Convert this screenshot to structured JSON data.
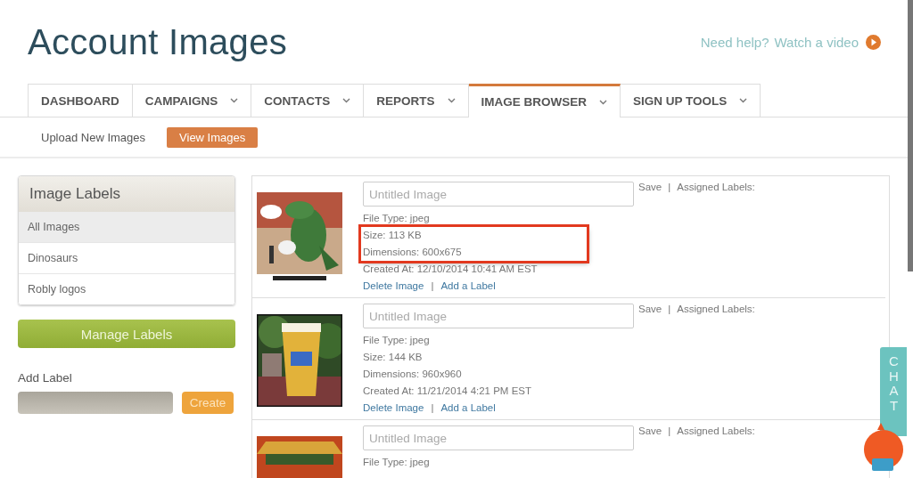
{
  "page": {
    "title": "Account Images",
    "help_text": "Need help?",
    "help_link": "Watch a video"
  },
  "tabs": [
    {
      "label": "DASHBOARD",
      "selected": false,
      "has_menu": false
    },
    {
      "label": "CAMPAIGNS",
      "selected": false,
      "has_menu": true
    },
    {
      "label": "CONTACTS",
      "selected": false,
      "has_menu": true
    },
    {
      "label": "REPORTS",
      "selected": false,
      "has_menu": true
    },
    {
      "label": "IMAGE BROWSER",
      "selected": true,
      "has_menu": true
    },
    {
      "label": "SIGN UP TOOLS",
      "selected": false,
      "has_menu": true
    }
  ],
  "subnav": [
    {
      "label": "Upload New Images",
      "selected": false
    },
    {
      "label": "View Images",
      "selected": true
    }
  ],
  "sidebar": {
    "title": "Image Labels",
    "labels": [
      {
        "label": "All Images",
        "selected": true
      },
      {
        "label": "Dinosaurs",
        "selected": false
      },
      {
        "label": "Robly logos",
        "selected": false
      }
    ],
    "manage_button": "Manage Labels",
    "add_label": {
      "heading": "Add Label",
      "button": "Create"
    }
  },
  "images": [
    {
      "kind": "comic",
      "placeholder": "Untitled Image",
      "save": "Save",
      "separator": "|",
      "assigned_labels": "Assigned Labels:",
      "file_type": "File Type: jpeg",
      "size": "Size: 113 KB",
      "dimensions": "Dimensions: 600x675",
      "created_at": "Created At: 12/10/2014 10:41 AM EST",
      "delete": "Delete Image",
      "add_label": "Add a Label",
      "highlighted": true
    },
    {
      "kind": "glass",
      "placeholder": "Untitled Image",
      "save": "Save",
      "separator": "|",
      "assigned_labels": "Assigned Labels:",
      "file_type": "File Type: jpeg",
      "size": "Size: 144 KB",
      "dimensions": "Dimensions: 960x960",
      "created_at": "Created At: 11/21/2014 4:21 PM EST",
      "delete": "Delete Image",
      "add_label": "Add a Label",
      "highlighted": false
    },
    {
      "kind": "banner",
      "placeholder": "Untitled Image",
      "save": "Save",
      "separator": "|",
      "assigned_labels": "Assigned Labels:",
      "file_type": "File Type: jpeg",
      "highlighted": false
    }
  ],
  "chat": {
    "label": "CHAT"
  }
}
